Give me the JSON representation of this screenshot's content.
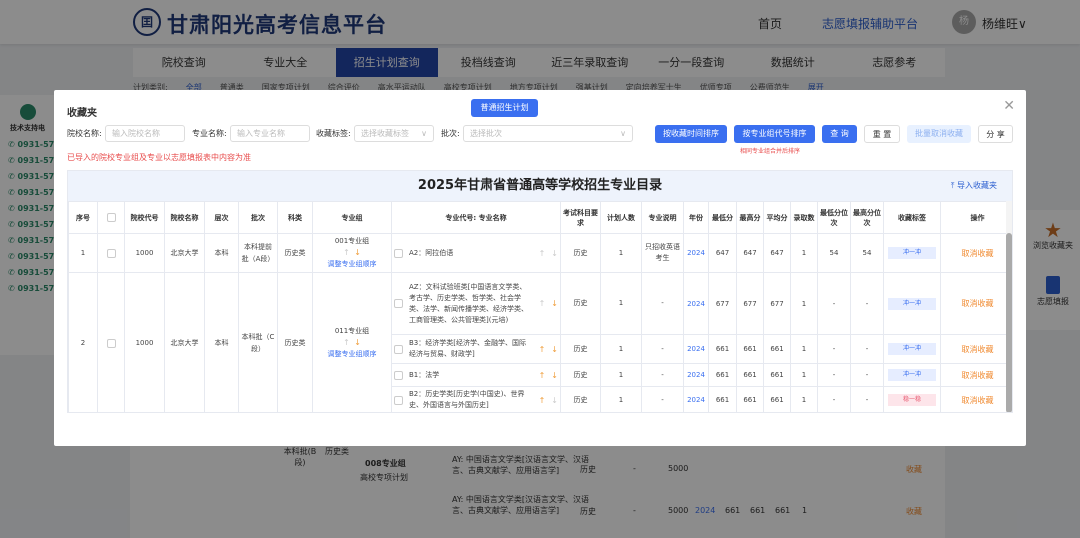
{
  "header": {
    "logo_text": "囯",
    "title": "甘肃阳光高考信息平台",
    "home": "首页",
    "platform": "志愿填报辅助平台",
    "avatar": "杨",
    "user": "杨维旺∨"
  },
  "nav": [
    "院校查询",
    "专业大全",
    "招生计划查询",
    "投档线查询",
    "近三年录取查询",
    "一分一段查询",
    "数据统计",
    "志愿参考"
  ],
  "subtabs": [
    "计划类别:",
    "全部",
    "普通类",
    "国家专项计划",
    "综合评价",
    "高水平运动队",
    "高校专项计划",
    "地方专项计划",
    "强基计划",
    "定向培养军士生",
    "优师专项",
    "公费师范生",
    "展开"
  ],
  "left_side": {
    "title": "技术支持电",
    "phones": [
      "0931-572",
      "0931-572",
      "0931-572",
      "0931-572",
      "0931-572",
      "0931-572",
      "0931-572",
      "0931-572",
      "0931-572",
      "0931-572"
    ]
  },
  "right_side": {
    "fav": "浏览收藏夹",
    "fill": "志愿填报"
  },
  "bg_table": {
    "rows": [
      {
        "batch": "本科批(B段)",
        "type": "历史类",
        "group": "008专业组",
        "group_sub": "高校专项计划",
        "major": "AY: 中国语言文学类[汉语言文学、汉语言、古典文献学、应用语言学]",
        "subj": "历史",
        "plan": "-",
        "fee": "5000",
        "action": "收藏"
      },
      {
        "major": "AY: 中国语言文学类[汉语言文学、汉语言、古典文献学、应用语言学]",
        "subj": "历史",
        "plan": "-",
        "fee": "5000",
        "year": "2024",
        "min": "661",
        "max": "661",
        "avg": "661",
        "num": "1",
        "action": "收藏"
      }
    ]
  },
  "modal": {
    "title": "收藏夹",
    "top_button": "普通招生计划",
    "filters": {
      "school_label": "院校名称:",
      "school_placeholder": "输入院校名称",
      "major_label": "专业名称:",
      "major_placeholder": "输入专业名称",
      "tag_label": "收藏标签:",
      "tag_placeholder": "选择收藏标签",
      "batch_label": "批次:",
      "batch_placeholder": "选择批次"
    },
    "buttons": {
      "sort_time": "按收藏时间排序",
      "sort_group": "按专业组代号排序",
      "query": "查 询",
      "reset": "重 置",
      "batch_cancel": "批量取消收藏",
      "share": "分 享"
    },
    "sort_hint": "相同专业组合并后排序",
    "warning": "已导入的院校专业组及专业以志愿填报表中内容为准",
    "table_title": "2025年甘肃省普通高等学校招生专业目录",
    "export": "⤒ 导入收藏夹",
    "columns": [
      "序号",
      "",
      "院校代号",
      "院校名称",
      "层次",
      "批次",
      "科类",
      "专业组",
      "专业代号: 专业名称",
      "考试科目要求",
      "计划人数",
      "专业说明",
      "年份",
      "最低分",
      "最高分",
      "平均分",
      "录取数",
      "最低分位次",
      "最高分位次",
      "收藏标签",
      "操作"
    ],
    "groups": [
      {
        "no": "1",
        "code": "1000",
        "school": "北京大学",
        "level": "本科",
        "batch": "本科提前批（A段）",
        "type": "历史类",
        "group": "001专业组",
        "adjust": "调整专业组顺序",
        "majors": [
          {
            "name": "A2：阿拉伯语",
            "subj": "历史",
            "plan": "1",
            "note": "只招收英语考生",
            "year": "2024",
            "min": "647",
            "max": "647",
            "avg": "647",
            "num": "1",
            "minrank": "54",
            "maxrank": "54",
            "tag": "冲一冲",
            "action": "取消收藏"
          }
        ]
      },
      {
        "no": "2",
        "code": "1000",
        "school": "北京大学",
        "level": "本科",
        "batch": "本科批（C段）",
        "type": "历史类",
        "group": "011专业组",
        "adjust": "调整专业组顺序",
        "majors": [
          {
            "name": "AZ：文科试验班类[中国语言文学类、考古学、历史学类、哲学类、社会学类、法学、新闻传播学类、经济学类、工商管理类、公共管理类](元培)",
            "subj": "历史",
            "plan": "1",
            "note": "-",
            "year": "2024",
            "min": "677",
            "max": "677",
            "avg": "677",
            "num": "1",
            "minrank": "-",
            "maxrank": "-",
            "tag": "冲一冲",
            "action": "取消收藏"
          },
          {
            "name": "B3：经济学类[经济学、金融学、国际经济与贸易、财政学]",
            "subj": "历史",
            "plan": "1",
            "note": "-",
            "year": "2024",
            "min": "661",
            "max": "661",
            "avg": "661",
            "num": "1",
            "minrank": "-",
            "maxrank": "-",
            "tag": "冲一冲",
            "action": "取消收藏"
          },
          {
            "name": "B1：法学",
            "subj": "历史",
            "plan": "1",
            "note": "-",
            "year": "2024",
            "min": "661",
            "max": "661",
            "avg": "661",
            "num": "1",
            "minrank": "-",
            "maxrank": "-",
            "tag": "冲一冲",
            "action": "取消收藏"
          },
          {
            "name": "B2：历史学类[历史学(中国史)、世界史、外国语言与外国历史]",
            "subj": "历史",
            "plan": "1",
            "note": "-",
            "year": "2024",
            "min": "661",
            "max": "661",
            "avg": "661",
            "num": "1",
            "minrank": "-",
            "maxrank": "-",
            "tag": "稳一稳",
            "action": "取消收藏"
          }
        ]
      }
    ]
  }
}
